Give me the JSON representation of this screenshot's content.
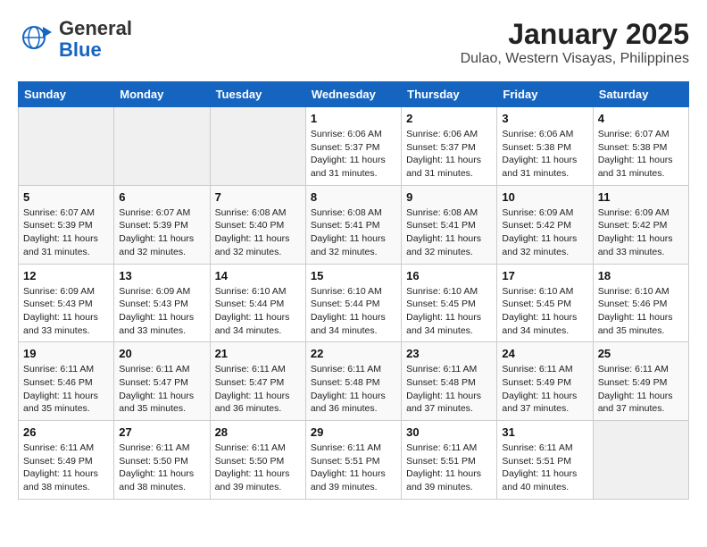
{
  "logo": {
    "line1": "General",
    "line2": "Blue"
  },
  "title": "January 2025",
  "subtitle": "Dulao, Western Visayas, Philippines",
  "days_of_week": [
    "Sunday",
    "Monday",
    "Tuesday",
    "Wednesday",
    "Thursday",
    "Friday",
    "Saturday"
  ],
  "weeks": [
    [
      {
        "day": "",
        "detail": ""
      },
      {
        "day": "",
        "detail": ""
      },
      {
        "day": "",
        "detail": ""
      },
      {
        "day": "1",
        "detail": "Sunrise: 6:06 AM\nSunset: 5:37 PM\nDaylight: 11 hours and 31 minutes."
      },
      {
        "day": "2",
        "detail": "Sunrise: 6:06 AM\nSunset: 5:37 PM\nDaylight: 11 hours and 31 minutes."
      },
      {
        "day": "3",
        "detail": "Sunrise: 6:06 AM\nSunset: 5:38 PM\nDaylight: 11 hours and 31 minutes."
      },
      {
        "day": "4",
        "detail": "Sunrise: 6:07 AM\nSunset: 5:38 PM\nDaylight: 11 hours and 31 minutes."
      }
    ],
    [
      {
        "day": "5",
        "detail": "Sunrise: 6:07 AM\nSunset: 5:39 PM\nDaylight: 11 hours and 31 minutes."
      },
      {
        "day": "6",
        "detail": "Sunrise: 6:07 AM\nSunset: 5:39 PM\nDaylight: 11 hours and 32 minutes."
      },
      {
        "day": "7",
        "detail": "Sunrise: 6:08 AM\nSunset: 5:40 PM\nDaylight: 11 hours and 32 minutes."
      },
      {
        "day": "8",
        "detail": "Sunrise: 6:08 AM\nSunset: 5:41 PM\nDaylight: 11 hours and 32 minutes."
      },
      {
        "day": "9",
        "detail": "Sunrise: 6:08 AM\nSunset: 5:41 PM\nDaylight: 11 hours and 32 minutes."
      },
      {
        "day": "10",
        "detail": "Sunrise: 6:09 AM\nSunset: 5:42 PM\nDaylight: 11 hours and 32 minutes."
      },
      {
        "day": "11",
        "detail": "Sunrise: 6:09 AM\nSunset: 5:42 PM\nDaylight: 11 hours and 33 minutes."
      }
    ],
    [
      {
        "day": "12",
        "detail": "Sunrise: 6:09 AM\nSunset: 5:43 PM\nDaylight: 11 hours and 33 minutes."
      },
      {
        "day": "13",
        "detail": "Sunrise: 6:09 AM\nSunset: 5:43 PM\nDaylight: 11 hours and 33 minutes."
      },
      {
        "day": "14",
        "detail": "Sunrise: 6:10 AM\nSunset: 5:44 PM\nDaylight: 11 hours and 34 minutes."
      },
      {
        "day": "15",
        "detail": "Sunrise: 6:10 AM\nSunset: 5:44 PM\nDaylight: 11 hours and 34 minutes."
      },
      {
        "day": "16",
        "detail": "Sunrise: 6:10 AM\nSunset: 5:45 PM\nDaylight: 11 hours and 34 minutes."
      },
      {
        "day": "17",
        "detail": "Sunrise: 6:10 AM\nSunset: 5:45 PM\nDaylight: 11 hours and 34 minutes."
      },
      {
        "day": "18",
        "detail": "Sunrise: 6:10 AM\nSunset: 5:46 PM\nDaylight: 11 hours and 35 minutes."
      }
    ],
    [
      {
        "day": "19",
        "detail": "Sunrise: 6:11 AM\nSunset: 5:46 PM\nDaylight: 11 hours and 35 minutes."
      },
      {
        "day": "20",
        "detail": "Sunrise: 6:11 AM\nSunset: 5:47 PM\nDaylight: 11 hours and 35 minutes."
      },
      {
        "day": "21",
        "detail": "Sunrise: 6:11 AM\nSunset: 5:47 PM\nDaylight: 11 hours and 36 minutes."
      },
      {
        "day": "22",
        "detail": "Sunrise: 6:11 AM\nSunset: 5:48 PM\nDaylight: 11 hours and 36 minutes."
      },
      {
        "day": "23",
        "detail": "Sunrise: 6:11 AM\nSunset: 5:48 PM\nDaylight: 11 hours and 37 minutes."
      },
      {
        "day": "24",
        "detail": "Sunrise: 6:11 AM\nSunset: 5:49 PM\nDaylight: 11 hours and 37 minutes."
      },
      {
        "day": "25",
        "detail": "Sunrise: 6:11 AM\nSunset: 5:49 PM\nDaylight: 11 hours and 37 minutes."
      }
    ],
    [
      {
        "day": "26",
        "detail": "Sunrise: 6:11 AM\nSunset: 5:49 PM\nDaylight: 11 hours and 38 minutes."
      },
      {
        "day": "27",
        "detail": "Sunrise: 6:11 AM\nSunset: 5:50 PM\nDaylight: 11 hours and 38 minutes."
      },
      {
        "day": "28",
        "detail": "Sunrise: 6:11 AM\nSunset: 5:50 PM\nDaylight: 11 hours and 39 minutes."
      },
      {
        "day": "29",
        "detail": "Sunrise: 6:11 AM\nSunset: 5:51 PM\nDaylight: 11 hours and 39 minutes."
      },
      {
        "day": "30",
        "detail": "Sunrise: 6:11 AM\nSunset: 5:51 PM\nDaylight: 11 hours and 39 minutes."
      },
      {
        "day": "31",
        "detail": "Sunrise: 6:11 AM\nSunset: 5:51 PM\nDaylight: 11 hours and 40 minutes."
      },
      {
        "day": "",
        "detail": ""
      }
    ]
  ]
}
